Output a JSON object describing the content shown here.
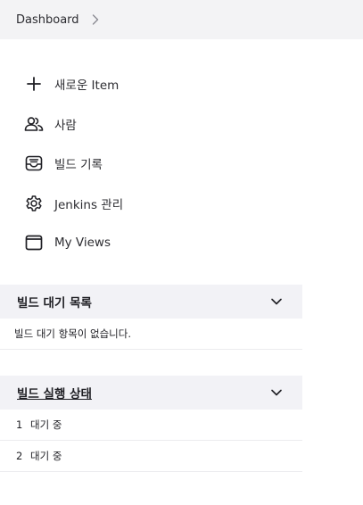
{
  "breadcrumb": {
    "items": [
      "Dashboard"
    ]
  },
  "tasks": [
    {
      "label": "새로운 Item",
      "icon": "plus-icon"
    },
    {
      "label": "사람",
      "icon": "people-icon"
    },
    {
      "label": "빌드 기록",
      "icon": "inbox-icon"
    },
    {
      "label": "Jenkins 관리",
      "icon": "gear-icon"
    },
    {
      "label": "My Views",
      "icon": "window-icon"
    }
  ],
  "build_queue": {
    "title": "빌드 대기 목록",
    "empty_message": "빌드 대기 항목이 없습니다."
  },
  "executors": {
    "title": "빌드 실행 상태",
    "rows": [
      {
        "number": "1",
        "status": "대기 중"
      },
      {
        "number": "2",
        "status": "대기 중"
      }
    ]
  },
  "colors": {
    "header_bg": "#f3f3f5",
    "pane_header_bg": "#f2f2f6",
    "text": "#1f1f24"
  }
}
